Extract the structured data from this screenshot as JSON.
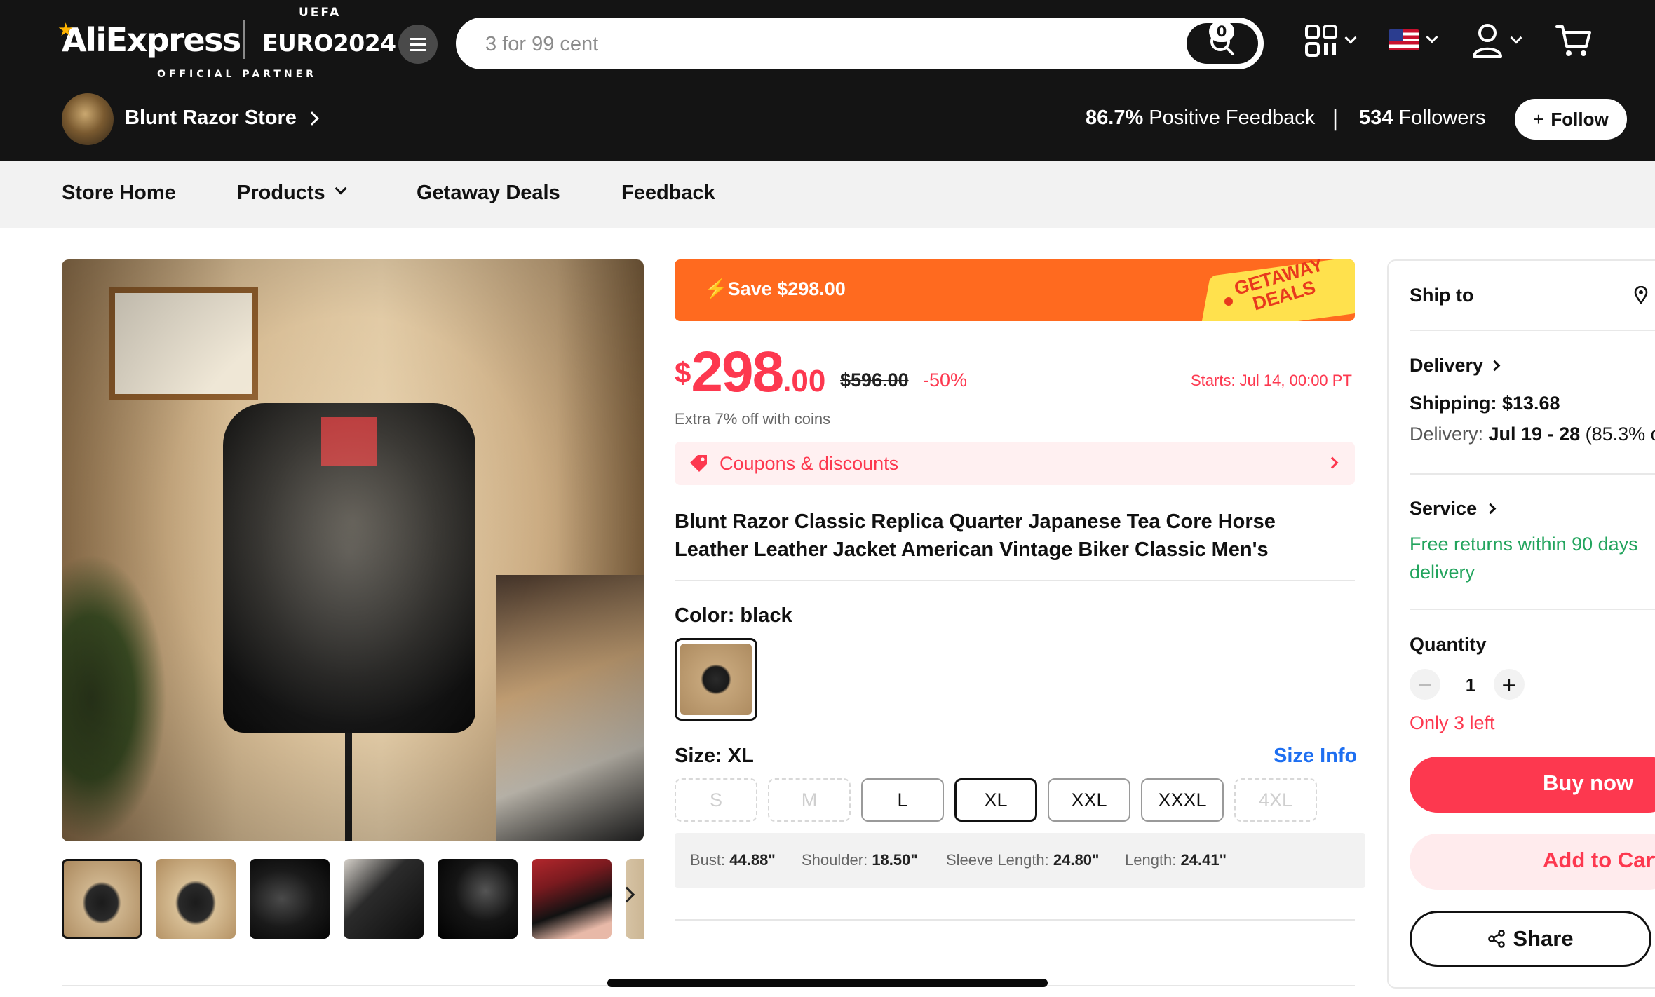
{
  "header": {
    "logo_text": "AliExpress",
    "partner_brand": "EURO2024",
    "partner_crest": "UEFA",
    "partner_tagline": "OFFICIAL PARTNER",
    "search_placeholder": "3 for 99 cent",
    "cart_count": "0",
    "region_flag": "us-flag",
    "icons": [
      "menu-icon",
      "search-icon",
      "qr-code-icon",
      "user-icon",
      "cart-icon"
    ]
  },
  "store": {
    "name": "Blunt Razor Store",
    "positive_feedback_value": "86.7%",
    "positive_feedback_label": "Positive Feedback",
    "separator": "|",
    "followers_value": "534",
    "followers_label": "Followers",
    "follow_label": "Follow"
  },
  "store_nav": {
    "items": [
      {
        "label": "Store Home"
      },
      {
        "label": "Products"
      },
      {
        "label": "Getaway Deals"
      },
      {
        "label": "Feedback"
      }
    ]
  },
  "gallery": {
    "thumbnail_count": 7
  },
  "product": {
    "save_banner": "Save $298.00",
    "deal_badge_line1": "GETAWAY",
    "deal_badge_line2": "DEALS",
    "price_currency": "$",
    "price_int": "298",
    "price_dec": ".00",
    "original_price": "$596.00",
    "discount": "-50%",
    "starts_text": "Starts:  Jul 14, 00:00 PT",
    "coins_text": "Extra 7% off with coins",
    "coupons_label": "Coupons & discounts",
    "title": "Blunt Razor Classic Replica Quarter Japanese Tea Core Horse Leather Leather Jacket American Vintage Biker Classic Men's",
    "color_label": "Color: black",
    "size_label": "Size: XL",
    "size_info_label": "Size Info",
    "sizes": [
      {
        "label": "S",
        "state": "disabled"
      },
      {
        "label": "M",
        "state": "disabled"
      },
      {
        "label": "L",
        "state": "available"
      },
      {
        "label": "XL",
        "state": "selected"
      },
      {
        "label": "XXL",
        "state": "available"
      },
      {
        "label": "XXXL",
        "state": "available"
      },
      {
        "label": "4XL",
        "state": "disabled"
      }
    ],
    "measurements": [
      {
        "name": "Bust:",
        "value": "44.88\""
      },
      {
        "name": "Shoulder:",
        "value": "18.50\""
      },
      {
        "name": "Sleeve Length:",
        "value": "24.80\""
      },
      {
        "name": "Length:",
        "value": "24.41\""
      }
    ]
  },
  "side_panel": {
    "ship_to_label": "Ship to",
    "delivery_label": "Delivery",
    "shipping_text": "Shipping: $13.68",
    "delivery_prefix": "Delivery: ",
    "delivery_dates": "Jul 19 - 28",
    "delivery_rate": " (85.3% o",
    "service_label": "Service",
    "service_text_line1": "Free returns within 90 days",
    "service_text_line2": "delivery",
    "quantity_label": "Quantity",
    "quantity_value": "1",
    "stock_text": "Only 3 left",
    "buy_now_label": "Buy now",
    "add_to_cart_label": "Add to Cart",
    "share_label": "Share"
  },
  "colors": {
    "accent_red": "#fd384f",
    "deal_orange": "#ff6a1f",
    "deal_badge_yellow": "#ffe14d",
    "link_blue": "#1e6ff1",
    "service_green": "#22a45d",
    "header_bg": "#141414"
  }
}
